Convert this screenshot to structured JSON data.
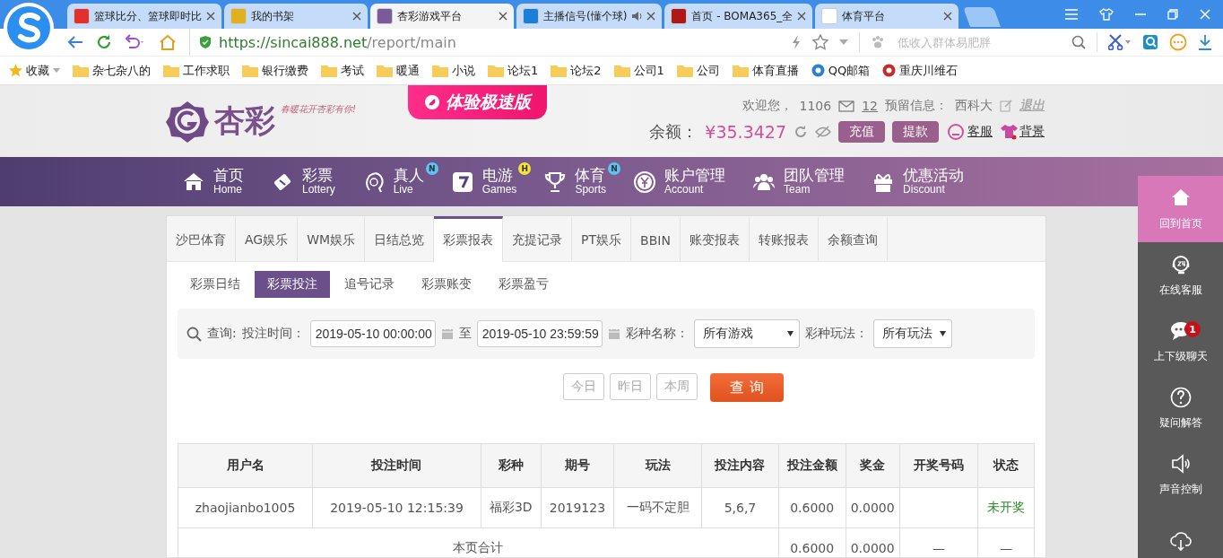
{
  "browser": {
    "tabs": [
      {
        "title": "篮球比分、篮球即时比",
        "selected": false,
        "color": "#e03030",
        "audio": false
      },
      {
        "title": "我的书架",
        "selected": false,
        "color": "#e0b020",
        "audio": false
      },
      {
        "title": "杏彩游戏平台",
        "selected": true,
        "color": "#7a5a9a",
        "audio": false
      },
      {
        "title": "主播信号(懂个球)",
        "selected": false,
        "color": "#1a7fd8",
        "audio": true
      },
      {
        "title": "首页 - BOMA365_全",
        "selected": false,
        "color": "#b01818",
        "audio": false
      },
      {
        "title": "体育平台",
        "selected": false,
        "color": "#ffffff",
        "audio": false
      }
    ],
    "url": {
      "host": "https://sincai888.net",
      "path": "/report/main"
    },
    "search": {
      "placeholder": "低收入群体易肥胖"
    },
    "bookmarks": [
      {
        "kind": "favorites",
        "label": "收藏"
      },
      {
        "kind": "folder",
        "label": "杂七杂八的"
      },
      {
        "kind": "folder",
        "label": "工作求职"
      },
      {
        "kind": "folder",
        "label": "银行缴费"
      },
      {
        "kind": "folder",
        "label": "考试"
      },
      {
        "kind": "folder",
        "label": "暖通"
      },
      {
        "kind": "folder",
        "label": "小说"
      },
      {
        "kind": "folder",
        "label": "论坛1"
      },
      {
        "kind": "folder",
        "label": "论坛2"
      },
      {
        "kind": "folder",
        "label": "公司1"
      },
      {
        "kind": "folder",
        "label": "公司"
      },
      {
        "kind": "folder",
        "label": "体育直播"
      },
      {
        "kind": "site",
        "label": "QQ邮箱",
        "color": "#2a7fd4"
      },
      {
        "kind": "site",
        "label": "重庆川维石",
        "color": "#c82828"
      }
    ]
  },
  "header": {
    "logo": "杏彩",
    "slogan": "春暖花开杏彩有你!",
    "promo": "体验极速版",
    "welcome": "欢迎您，",
    "user": "1106",
    "messages": "12",
    "reserved_label": "预留信息：",
    "reserved_value": "西科大",
    "logout": "退出",
    "balance_label": "余额：",
    "balance": "¥35.3427",
    "deposit": "充值",
    "withdraw": "提款",
    "service": "客服",
    "background": "背景"
  },
  "nav": [
    {
      "kind": "home",
      "title": "首页",
      "subtitle": "Home"
    },
    {
      "kind": "lottery",
      "title": "彩票",
      "subtitle": "Lottery"
    },
    {
      "kind": "live",
      "title": "真人",
      "subtitle": "Live",
      "badge": {
        "text": "N",
        "color": "#5bc4f2"
      }
    },
    {
      "kind": "games",
      "title": "电游",
      "subtitle": "Games",
      "badge": {
        "text": "H",
        "color": "#f2e23a"
      }
    },
    {
      "kind": "sports",
      "title": "体育",
      "subtitle": "Sports",
      "badge": {
        "text": "N",
        "color": "#5bc4f2"
      }
    },
    {
      "kind": "account",
      "title": "账户管理",
      "subtitle": "Account"
    },
    {
      "kind": "team",
      "title": "团队管理",
      "subtitle": "Team"
    },
    {
      "kind": "discount",
      "title": "优惠活动",
      "subtitle": "Discount"
    }
  ],
  "side_panel": [
    {
      "kind": "home",
      "label": "回到首页",
      "selected": true
    },
    {
      "kind": "service",
      "label": "在线客服",
      "selected": false
    },
    {
      "kind": "chat",
      "label": "上下级聊天",
      "selected": false,
      "badge": "1"
    },
    {
      "kind": "help",
      "label": "疑问解答",
      "selected": false
    },
    {
      "kind": "sound",
      "label": "声音控制",
      "selected": false
    },
    {
      "kind": "download",
      "selected": false
    }
  ],
  "report": {
    "tabs": [
      {
        "label": "沙巴体育",
        "selected": false
      },
      {
        "label": "AG娱乐",
        "selected": false
      },
      {
        "label": "WM娱乐",
        "selected": false
      },
      {
        "label": "日结总览",
        "selected": false
      },
      {
        "label": "彩票报表",
        "selected": true
      },
      {
        "label": "充提记录",
        "selected": false
      },
      {
        "label": "PT娱乐",
        "selected": false
      },
      {
        "label": "BBIN",
        "selected": false
      },
      {
        "label": "账变报表",
        "selected": false
      },
      {
        "label": "转账报表",
        "selected": false
      },
      {
        "label": "余额查询",
        "selected": false
      }
    ],
    "subtabs": [
      {
        "label": "彩票日结",
        "selected": false
      },
      {
        "label": "彩票投注",
        "selected": true
      },
      {
        "label": "追号记录",
        "selected": false
      },
      {
        "label": "彩票账变",
        "selected": false
      },
      {
        "label": "彩票盈亏",
        "selected": false
      }
    ],
    "filter": {
      "label": "查询:",
      "time_label": "投注时间：",
      "start": "2019-05-10 00:00:00",
      "to": "至",
      "end": "2019-05-10 23:59:59",
      "game_label": "彩种名称：",
      "game_value": "所有游戏",
      "play_label": "彩种玩法：",
      "play_value": "所有玩法"
    },
    "quick_buttons": [
      "今日",
      "昨日",
      "本周"
    ],
    "search_button": "查 询",
    "table": {
      "columns": [
        "用户名",
        "投注时间",
        "彩种",
        "期号",
        "玩法",
        "投注内容",
        "投注金额",
        "奖金",
        "开奖号码",
        "状态"
      ],
      "rows": [
        {
          "cells": [
            "zhaojianbo1005",
            "2019-05-10 12:15:39",
            "福彩3D",
            "2019123",
            "一码不定胆",
            "5,6,7",
            "0.6000",
            "0.0000",
            ""
          ],
          "status": {
            "text": "未开奖",
            "color": "#2e8b2e"
          }
        }
      ],
      "summary": {
        "label": "本页合计",
        "cells": [
          "0.6000",
          "0.0000",
          "—",
          "—"
        ]
      }
    }
  }
}
